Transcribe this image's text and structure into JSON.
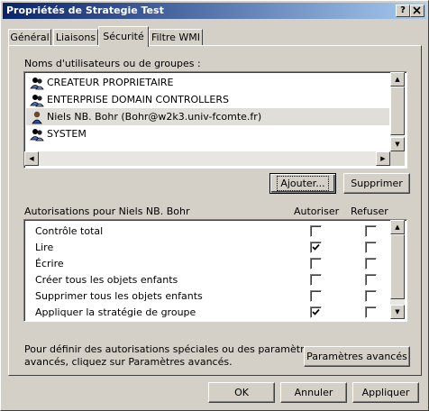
{
  "window": {
    "title": "Propriétés de Strategie Test",
    "help_label": "?",
    "close_label": "×"
  },
  "tabs": [
    {
      "label": "Général"
    },
    {
      "label": "Liaisons"
    },
    {
      "label": "Sécurité"
    },
    {
      "label": "Filtre WMI"
    }
  ],
  "active_tab": "Sécurité",
  "users": {
    "label": "Noms d'utilisateurs ou de groupes :",
    "items": [
      {
        "name": "CREATEUR PROPRIETAIRE",
        "icon": "group-icon"
      },
      {
        "name": "ENTERPRISE DOMAIN CONTROLLERS",
        "icon": "group-icon"
      },
      {
        "name": "Niels NB. Bohr (Bohr@w2k3.univ-fcomte.fr)",
        "icon": "user-icon",
        "selected": true
      },
      {
        "name": "SYSTEM",
        "icon": "group-icon"
      }
    ],
    "add_button": "Ajouter...",
    "remove_button": "Supprimer"
  },
  "permissions": {
    "label": "Autorisations pour Niels NB. Bohr",
    "allow_header": "Autoriser",
    "deny_header": "Refuser",
    "rows": [
      {
        "name": "Contrôle total",
        "allow": false,
        "deny": false
      },
      {
        "name": "Lire",
        "allow": true,
        "deny": false
      },
      {
        "name": "Écrire",
        "allow": false,
        "deny": false
      },
      {
        "name": "Créer tous les objets enfants",
        "allow": false,
        "deny": false
      },
      {
        "name": "Supprimer tous les objets enfants",
        "allow": false,
        "deny": false
      },
      {
        "name": "Appliquer la stratégie de groupe",
        "allow": true,
        "deny": false
      }
    ]
  },
  "advanced": {
    "text_line1": "Pour définir des autorisations spéciales ou des paramètres",
    "text_line2": "avancés, cliquez sur Paramètres avancés.",
    "button": "Paramètres avancés"
  },
  "footer": {
    "ok": "OK",
    "cancel": "Annuler",
    "apply": "Appliquer"
  },
  "colors": {
    "title_gradient_start": "#0a246a",
    "title_gradient_end": "#a6caf0",
    "face": "#d4d0c8",
    "selection_bg": "#e0ded9"
  }
}
